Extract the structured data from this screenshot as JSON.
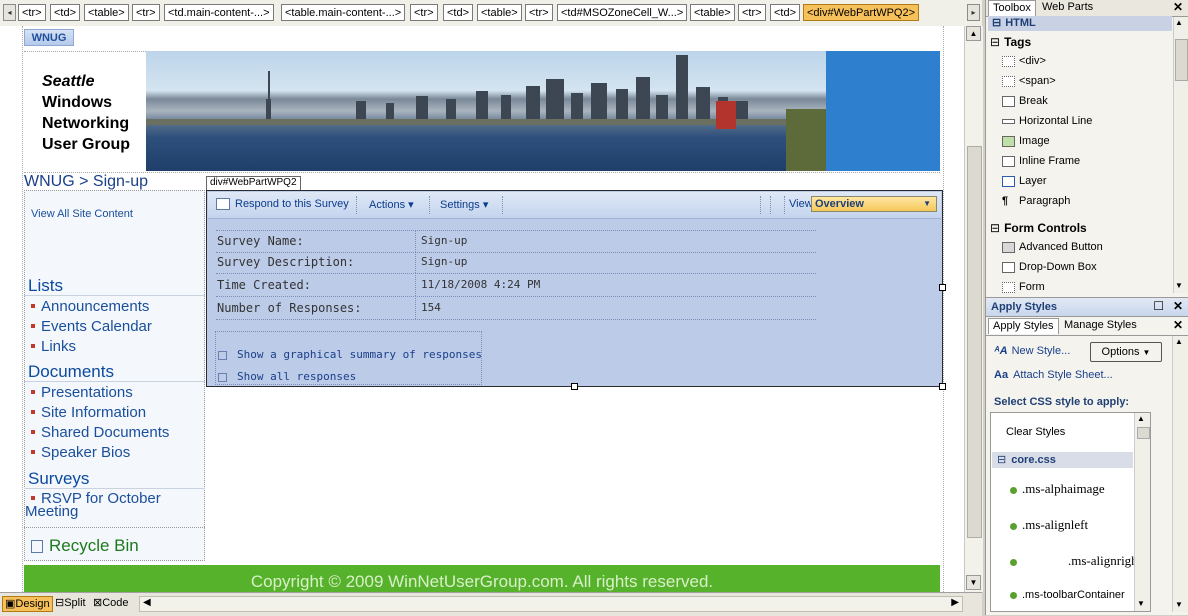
{
  "tagbar": {
    "tags": [
      "<tr>",
      "<td>",
      "<table>",
      "<tr>",
      "<td.main-content-...>",
      "<table.main-content-...>",
      "<tr>",
      "<td>",
      "<table>",
      "<tr>",
      "<td#MSOZoneCell_W...>",
      "<table>",
      "<tr>",
      "<td>",
      "<div#WebPartWPQ2>"
    ],
    "left_arrow": "◂",
    "right_arrow": "▸"
  },
  "site": {
    "top_tab": "WNUG",
    "logo_lines": [
      "Seattle",
      "Windows",
      "Networking",
      "User Group"
    ],
    "breadcrumb": "WNUG > Sign-up",
    "webpart_label": "div#WebPartWPQ2"
  },
  "nav": {
    "view_all": "View All Site Content",
    "lists_heading": "Lists",
    "lists": [
      "Announcements",
      "Events Calendar",
      "Links"
    ],
    "documents_heading": "Documents",
    "documents": [
      "Presentations",
      "Site Information",
      "Shared Documents",
      "Speaker Bios"
    ],
    "surveys_heading": "Surveys",
    "surveys": [
      "RSVP for October Meeting"
    ],
    "recycle_bin": "Recycle Bin"
  },
  "survey": {
    "toolbar": {
      "respond": "Respond to this Survey",
      "actions": "Actions",
      "settings": "Settings",
      "view_label": "View:",
      "view_value": "Overview"
    },
    "fields": [
      {
        "label": "Survey Name:",
        "value": "Sign-up"
      },
      {
        "label": "Survey Description:",
        "value": "Sign-up"
      },
      {
        "label": "Time Created:",
        "value": "11/18/2008 4:24 PM"
      },
      {
        "label": "Number of Responses:",
        "value": "154"
      }
    ],
    "links": [
      "Show a graphical summary of responses",
      "Show all responses"
    ]
  },
  "footer": {
    "copyright": "Copyright © 2009 WinNetUserGroup.com. All rights reserved."
  },
  "bottombar": {
    "design": "Design",
    "split": "Split",
    "code": "Code"
  },
  "toolbox": {
    "tab_toolbox": "Toolbox",
    "tab_webparts": "Web Parts",
    "html_heading": "HTML",
    "tags_heading": "Tags",
    "tags": [
      "<div>",
      "<span>",
      "Break",
      "Horizontal Line",
      "Image",
      "Inline Frame",
      "Layer",
      "Paragraph"
    ],
    "form_heading": "Form Controls",
    "form_items": [
      "Advanced Button",
      "Drop-Down Box",
      "Form"
    ]
  },
  "apply_styles": {
    "panel_title": "Apply Styles",
    "tab_apply": "Apply Styles",
    "tab_manage": "Manage Styles",
    "new_style": "New Style...",
    "options": "Options",
    "attach": "Attach Style Sheet...",
    "select_label": "Select CSS style to apply:",
    "clear": "Clear Styles",
    "sheet": "core.css",
    "styles": [
      ".ms-alphaimage",
      ".ms-alignleft",
      ".ms-alignright",
      ".ms-toolbarContainer"
    ]
  }
}
